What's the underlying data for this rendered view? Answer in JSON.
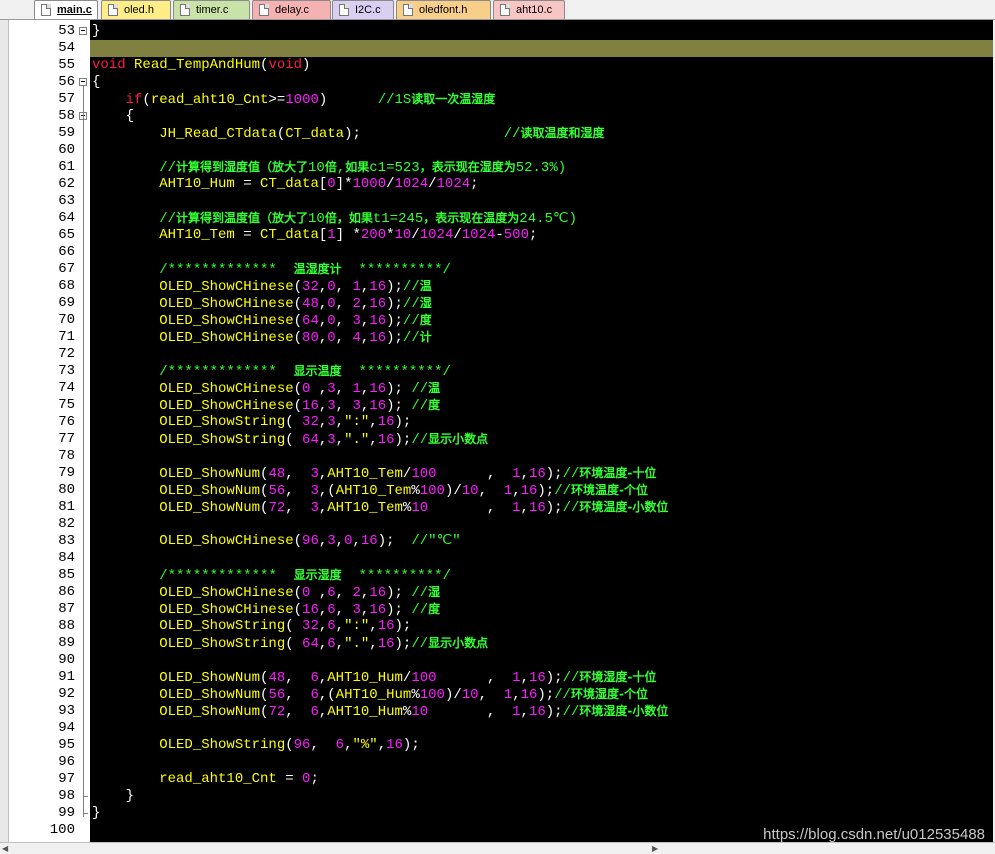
{
  "tabs": [
    {
      "label": "main.c",
      "color": "#ffffff",
      "active": true
    },
    {
      "label": "oled.h",
      "color": "#ffee88"
    },
    {
      "label": "timer.c",
      "color": "#c8e2a8"
    },
    {
      "label": "delay.c",
      "color": "#f6b2b2"
    },
    {
      "label": "I2C.c",
      "color": "#d8cff2"
    },
    {
      "label": "oledfont.h",
      "color": "#f7cf8a"
    },
    {
      "label": "aht10.c",
      "color": "#f8c5c5"
    }
  ],
  "line_numbers": [
    "53",
    "54",
    "55",
    "56",
    "57",
    "58",
    "59",
    "60",
    "61",
    "62",
    "63",
    "64",
    "65",
    "66",
    "67",
    "68",
    "69",
    "70",
    "71",
    "72",
    "73",
    "74",
    "75",
    "76",
    "77",
    "78",
    "79",
    "80",
    "81",
    "82",
    "83",
    "84",
    "85",
    "86",
    "87",
    "88",
    "89",
    "90",
    "91",
    "92",
    "93",
    "94",
    "95",
    "96",
    "97",
    "98",
    "99",
    "100"
  ],
  "highlight_line": "54",
  "colors": {
    "editor_background": "#000000",
    "keyword": "#ff1a4a",
    "function": "#ffff00",
    "number": "#ff1aff",
    "comment": "#33ff33",
    "current_line_highlight": "#808040"
  },
  "code_lines": [
    [
      [
        "op",
        "}"
      ]
    ],
    [],
    [
      [
        "kw",
        "void"
      ],
      [
        "fn",
        " Read_TempAndHum"
      ],
      [
        "op",
        "("
      ],
      [
        "kw",
        "void"
      ],
      [
        "op",
        ")"
      ]
    ],
    [
      [
        "op",
        "{"
      ]
    ],
    [
      [
        "kw",
        "    if"
      ],
      [
        "op",
        "("
      ],
      [
        "fn",
        "read_aht10_Cnt"
      ],
      [
        "op",
        ">="
      ],
      [
        "num",
        "1000"
      ],
      [
        "op",
        ")"
      ],
      [
        "cm",
        "      //1S"
      ],
      [
        "cmcn",
        "读取一次温湿度"
      ]
    ],
    [
      [
        "op",
        "    {"
      ]
    ],
    [
      [
        "fn",
        "        JH_Read_CTdata"
      ],
      [
        "op",
        "("
      ],
      [
        "fn",
        "CT_data"
      ],
      [
        "op",
        ");"
      ],
      [
        "cm",
        "                 //"
      ],
      [
        "cmcn",
        "读取温度和湿度"
      ]
    ],
    [],
    [
      [
        "cm",
        "        //"
      ],
      [
        "cmcn",
        "计算得到湿度值（放大了"
      ],
      [
        "cm",
        "10"
      ],
      [
        "cmcn",
        "倍"
      ],
      [
        "cm",
        ","
      ],
      [
        "cmcn",
        "如果"
      ],
      [
        "cm",
        "c1=523"
      ],
      [
        "cmcn",
        "，表示现在湿度为"
      ],
      [
        "cm",
        "52.3%)"
      ]
    ],
    [
      [
        "fn",
        "        AHT10_Hum "
      ],
      [
        "op",
        "= "
      ],
      [
        "fn",
        "CT_data"
      ],
      [
        "op",
        "["
      ],
      [
        "num",
        "0"
      ],
      [
        "op",
        "]*"
      ],
      [
        "num",
        "1000"
      ],
      [
        "op",
        "/"
      ],
      [
        "num",
        "1024"
      ],
      [
        "op",
        "/"
      ],
      [
        "num",
        "1024"
      ],
      [
        "op",
        ";"
      ]
    ],
    [],
    [
      [
        "cm",
        "        //"
      ],
      [
        "cmcn",
        "计算得到温度值（放大了"
      ],
      [
        "cm",
        "10"
      ],
      [
        "cmcn",
        "倍，如果"
      ],
      [
        "cm",
        "t1=245"
      ],
      [
        "cmcn",
        "，表示现在温度为"
      ],
      [
        "cm",
        "24.5℃)"
      ]
    ],
    [
      [
        "fn",
        "        AHT10_Tem "
      ],
      [
        "op",
        "= "
      ],
      [
        "fn",
        "CT_data"
      ],
      [
        "op",
        "["
      ],
      [
        "num",
        "1"
      ],
      [
        "op",
        "] *"
      ],
      [
        "num",
        "200"
      ],
      [
        "op",
        "*"
      ],
      [
        "num",
        "10"
      ],
      [
        "op",
        "/"
      ],
      [
        "num",
        "1024"
      ],
      [
        "op",
        "/"
      ],
      [
        "num",
        "1024"
      ],
      [
        "op",
        "-"
      ],
      [
        "num",
        "500"
      ],
      [
        "op",
        ";"
      ]
    ],
    [],
    [
      [
        "cm",
        "        /*************  "
      ],
      [
        "cmcn",
        "温湿度计"
      ],
      [
        "cm",
        "  **********/"
      ]
    ],
    [
      [
        "fn",
        "        OLED_ShowCHinese"
      ],
      [
        "op",
        "("
      ],
      [
        "num",
        "32"
      ],
      [
        "op",
        ","
      ],
      [
        "num",
        "0"
      ],
      [
        "op",
        ", "
      ],
      [
        "num",
        "1"
      ],
      [
        "op",
        ","
      ],
      [
        "num",
        "16"
      ],
      [
        "op",
        ");"
      ],
      [
        "cm",
        "//"
      ],
      [
        "cmcn",
        "温"
      ]
    ],
    [
      [
        "fn",
        "        OLED_ShowCHinese"
      ],
      [
        "op",
        "("
      ],
      [
        "num",
        "48"
      ],
      [
        "op",
        ","
      ],
      [
        "num",
        "0"
      ],
      [
        "op",
        ", "
      ],
      [
        "num",
        "2"
      ],
      [
        "op",
        ","
      ],
      [
        "num",
        "16"
      ],
      [
        "op",
        ");"
      ],
      [
        "cm",
        "//"
      ],
      [
        "cmcn",
        "湿"
      ]
    ],
    [
      [
        "fn",
        "        OLED_ShowCHinese"
      ],
      [
        "op",
        "("
      ],
      [
        "num",
        "64"
      ],
      [
        "op",
        ","
      ],
      [
        "num",
        "0"
      ],
      [
        "op",
        ", "
      ],
      [
        "num",
        "3"
      ],
      [
        "op",
        ","
      ],
      [
        "num",
        "16"
      ],
      [
        "op",
        ");"
      ],
      [
        "cm",
        "//"
      ],
      [
        "cmcn",
        "度"
      ]
    ],
    [
      [
        "fn",
        "        OLED_ShowCHinese"
      ],
      [
        "op",
        "("
      ],
      [
        "num",
        "80"
      ],
      [
        "op",
        ","
      ],
      [
        "num",
        "0"
      ],
      [
        "op",
        ", "
      ],
      [
        "num",
        "4"
      ],
      [
        "op",
        ","
      ],
      [
        "num",
        "16"
      ],
      [
        "op",
        ");"
      ],
      [
        "cm",
        "//"
      ],
      [
        "cmcn",
        "计"
      ]
    ],
    [],
    [
      [
        "cm",
        "        /*************  "
      ],
      [
        "cmcn",
        "显示温度"
      ],
      [
        "cm",
        "  **********/"
      ]
    ],
    [
      [
        "fn",
        "        OLED_ShowCHinese"
      ],
      [
        "op",
        "("
      ],
      [
        "num",
        "0"
      ],
      [
        "op",
        " ,"
      ],
      [
        "num",
        "3"
      ],
      [
        "op",
        ", "
      ],
      [
        "num",
        "1"
      ],
      [
        "op",
        ","
      ],
      [
        "num",
        "16"
      ],
      [
        "op",
        "); "
      ],
      [
        "cm",
        "//"
      ],
      [
        "cmcn",
        "温"
      ]
    ],
    [
      [
        "fn",
        "        OLED_ShowCHinese"
      ],
      [
        "op",
        "("
      ],
      [
        "num",
        "16"
      ],
      [
        "op",
        ","
      ],
      [
        "num",
        "3"
      ],
      [
        "op",
        ", "
      ],
      [
        "num",
        "3"
      ],
      [
        "op",
        ","
      ],
      [
        "num",
        "16"
      ],
      [
        "op",
        "); "
      ],
      [
        "cm",
        "//"
      ],
      [
        "cmcn",
        "度"
      ]
    ],
    [
      [
        "fn",
        "        OLED_ShowString"
      ],
      [
        "op",
        "( "
      ],
      [
        "num",
        "32"
      ],
      [
        "op",
        ","
      ],
      [
        "num",
        "3"
      ],
      [
        "op",
        ","
      ],
      [
        "str",
        "\":\""
      ],
      [
        "op",
        ","
      ],
      [
        "num",
        "16"
      ],
      [
        "op",
        ");"
      ]
    ],
    [
      [
        "fn",
        "        OLED_ShowString"
      ],
      [
        "op",
        "( "
      ],
      [
        "num",
        "64"
      ],
      [
        "op",
        ","
      ],
      [
        "num",
        "3"
      ],
      [
        "op",
        ","
      ],
      [
        "str",
        "\".\""
      ],
      [
        "op",
        ","
      ],
      [
        "num",
        "16"
      ],
      [
        "op",
        ");"
      ],
      [
        "cm",
        "//"
      ],
      [
        "cmcn",
        "显示小数点"
      ]
    ],
    [],
    [
      [
        "fn",
        "        OLED_ShowNum"
      ],
      [
        "op",
        "("
      ],
      [
        "num",
        "48"
      ],
      [
        "op",
        ",  "
      ],
      [
        "num",
        "3"
      ],
      [
        "op",
        ","
      ],
      [
        "fn",
        "AHT10_Tem"
      ],
      [
        "op",
        "/"
      ],
      [
        "num",
        "100"
      ],
      [
        "op",
        "      ,  "
      ],
      [
        "num",
        "1"
      ],
      [
        "op",
        ","
      ],
      [
        "num",
        "16"
      ],
      [
        "op",
        ");"
      ],
      [
        "cm",
        "//"
      ],
      [
        "cmcn",
        "环境温度-十位"
      ]
    ],
    [
      [
        "fn",
        "        OLED_ShowNum"
      ],
      [
        "op",
        "("
      ],
      [
        "num",
        "56"
      ],
      [
        "op",
        ",  "
      ],
      [
        "num",
        "3"
      ],
      [
        "op",
        ",("
      ],
      [
        "fn",
        "AHT10_Tem"
      ],
      [
        "op",
        "%"
      ],
      [
        "num",
        "100"
      ],
      [
        "op",
        ")/"
      ],
      [
        "num",
        "10"
      ],
      [
        "op",
        ",  "
      ],
      [
        "num",
        "1"
      ],
      [
        "op",
        ","
      ],
      [
        "num",
        "16"
      ],
      [
        "op",
        ");"
      ],
      [
        "cm",
        "//"
      ],
      [
        "cmcn",
        "环境温度-个位"
      ]
    ],
    [
      [
        "fn",
        "        OLED_ShowNum"
      ],
      [
        "op",
        "("
      ],
      [
        "num",
        "72"
      ],
      [
        "op",
        ",  "
      ],
      [
        "num",
        "3"
      ],
      [
        "op",
        ","
      ],
      [
        "fn",
        "AHT10_Tem"
      ],
      [
        "op",
        "%"
      ],
      [
        "num",
        "10"
      ],
      [
        "op",
        "       ,  "
      ],
      [
        "num",
        "1"
      ],
      [
        "op",
        ","
      ],
      [
        "num",
        "16"
      ],
      [
        "op",
        ");"
      ],
      [
        "cm",
        "//"
      ],
      [
        "cmcn",
        "环境温度-小数位"
      ]
    ],
    [],
    [
      [
        "fn",
        "        OLED_ShowCHinese"
      ],
      [
        "op",
        "("
      ],
      [
        "num",
        "96"
      ],
      [
        "op",
        ","
      ],
      [
        "num",
        "3"
      ],
      [
        "op",
        ","
      ],
      [
        "num",
        "0"
      ],
      [
        "op",
        ","
      ],
      [
        "num",
        "16"
      ],
      [
        "op",
        ");  "
      ],
      [
        "cm",
        "//\"℃\""
      ]
    ],
    [],
    [
      [
        "cm",
        "        /*************  "
      ],
      [
        "cmcn",
        "显示湿度"
      ],
      [
        "cm",
        "  **********/"
      ]
    ],
    [
      [
        "fn",
        "        OLED_ShowCHinese"
      ],
      [
        "op",
        "("
      ],
      [
        "num",
        "0"
      ],
      [
        "op",
        " ,"
      ],
      [
        "num",
        "6"
      ],
      [
        "op",
        ", "
      ],
      [
        "num",
        "2"
      ],
      [
        "op",
        ","
      ],
      [
        "num",
        "16"
      ],
      [
        "op",
        "); "
      ],
      [
        "cm",
        "//"
      ],
      [
        "cmcn",
        "湿"
      ]
    ],
    [
      [
        "fn",
        "        OLED_ShowCHinese"
      ],
      [
        "op",
        "("
      ],
      [
        "num",
        "16"
      ],
      [
        "op",
        ","
      ],
      [
        "num",
        "6"
      ],
      [
        "op",
        ", "
      ],
      [
        "num",
        "3"
      ],
      [
        "op",
        ","
      ],
      [
        "num",
        "16"
      ],
      [
        "op",
        "); "
      ],
      [
        "cm",
        "//"
      ],
      [
        "cmcn",
        "度"
      ]
    ],
    [
      [
        "fn",
        "        OLED_ShowString"
      ],
      [
        "op",
        "( "
      ],
      [
        "num",
        "32"
      ],
      [
        "op",
        ","
      ],
      [
        "num",
        "6"
      ],
      [
        "op",
        ","
      ],
      [
        "str",
        "\":\""
      ],
      [
        "op",
        ","
      ],
      [
        "num",
        "16"
      ],
      [
        "op",
        ");"
      ]
    ],
    [
      [
        "fn",
        "        OLED_ShowString"
      ],
      [
        "op",
        "( "
      ],
      [
        "num",
        "64"
      ],
      [
        "op",
        ","
      ],
      [
        "num",
        "6"
      ],
      [
        "op",
        ","
      ],
      [
        "str",
        "\".\""
      ],
      [
        "op",
        ","
      ],
      [
        "num",
        "16"
      ],
      [
        "op",
        ");"
      ],
      [
        "cm",
        "//"
      ],
      [
        "cmcn",
        "显示小数点"
      ]
    ],
    [],
    [
      [
        "fn",
        "        OLED_ShowNum"
      ],
      [
        "op",
        "("
      ],
      [
        "num",
        "48"
      ],
      [
        "op",
        ",  "
      ],
      [
        "num",
        "6"
      ],
      [
        "op",
        ","
      ],
      [
        "fn",
        "AHT10_Hum"
      ],
      [
        "op",
        "/"
      ],
      [
        "num",
        "100"
      ],
      [
        "op",
        "      ,  "
      ],
      [
        "num",
        "1"
      ],
      [
        "op",
        ","
      ],
      [
        "num",
        "16"
      ],
      [
        "op",
        ");"
      ],
      [
        "cm",
        "//"
      ],
      [
        "cmcn",
        "环境湿度-十位"
      ]
    ],
    [
      [
        "fn",
        "        OLED_ShowNum"
      ],
      [
        "op",
        "("
      ],
      [
        "num",
        "56"
      ],
      [
        "op",
        ",  "
      ],
      [
        "num",
        "6"
      ],
      [
        "op",
        ",("
      ],
      [
        "fn",
        "AHT10_Hum"
      ],
      [
        "op",
        "%"
      ],
      [
        "num",
        "100"
      ],
      [
        "op",
        ")/"
      ],
      [
        "num",
        "10"
      ],
      [
        "op",
        ",  "
      ],
      [
        "num",
        "1"
      ],
      [
        "op",
        ","
      ],
      [
        "num",
        "16"
      ],
      [
        "op",
        ");"
      ],
      [
        "cm",
        "//"
      ],
      [
        "cmcn",
        "环境湿度-个位"
      ]
    ],
    [
      [
        "fn",
        "        OLED_ShowNum"
      ],
      [
        "op",
        "("
      ],
      [
        "num",
        "72"
      ],
      [
        "op",
        ",  "
      ],
      [
        "num",
        "6"
      ],
      [
        "op",
        ","
      ],
      [
        "fn",
        "AHT10_Hum"
      ],
      [
        "op",
        "%"
      ],
      [
        "num",
        "10"
      ],
      [
        "op",
        "       ,  "
      ],
      [
        "num",
        "1"
      ],
      [
        "op",
        ","
      ],
      [
        "num",
        "16"
      ],
      [
        "op",
        ");"
      ],
      [
        "cm",
        "//"
      ],
      [
        "cmcn",
        "环境湿度-小数位"
      ]
    ],
    [],
    [
      [
        "fn",
        "        OLED_ShowString"
      ],
      [
        "op",
        "("
      ],
      [
        "num",
        "96"
      ],
      [
        "op",
        ",  "
      ],
      [
        "num",
        "6"
      ],
      [
        "op",
        ","
      ],
      [
        "str",
        "\"%\""
      ],
      [
        "op",
        ","
      ],
      [
        "num",
        "16"
      ],
      [
        "op",
        ");"
      ]
    ],
    [],
    [
      [
        "fn",
        "        read_aht10_Cnt "
      ],
      [
        "op",
        "= "
      ],
      [
        "num",
        "0"
      ],
      [
        "op",
        ";"
      ]
    ],
    [
      [
        "op",
        "    }"
      ]
    ],
    [
      [
        "op",
        "}"
      ]
    ],
    []
  ],
  "watermark": "https://blog.csdn.net/u012535488"
}
